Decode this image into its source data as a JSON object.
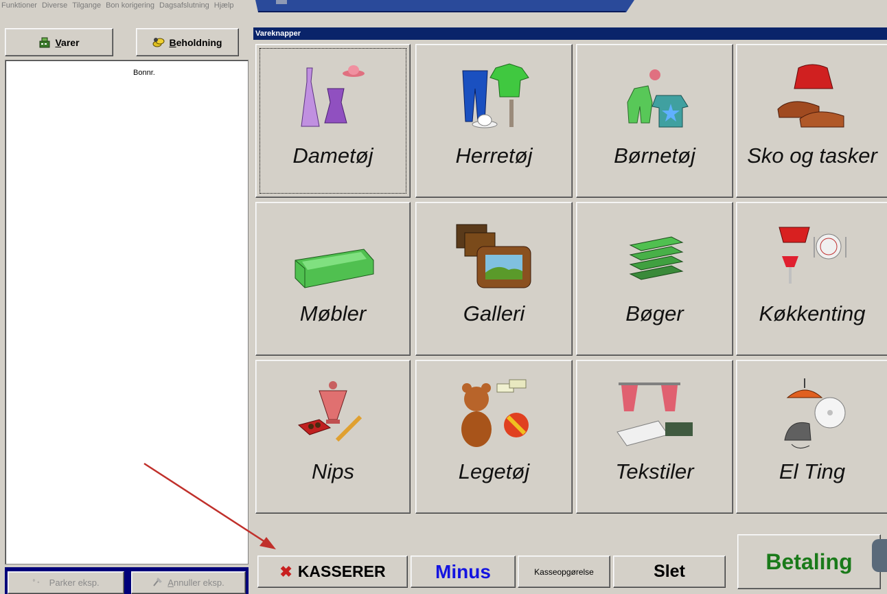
{
  "menu": [
    "Funktioner",
    "Diverse",
    "Tilgange",
    "Bon korigering",
    "Dagsafslutning",
    "Hjælp"
  ],
  "left": {
    "varer_label": "Varer",
    "varer_key": "V",
    "beholdning_label": "Beholdning",
    "beholdning_key": "B",
    "list_header": "Bonnr.",
    "parker_label": "Parker eksp.",
    "annuller_label": "Annuller eksp.",
    "annuller_key": "A"
  },
  "panel": {
    "title": "Vareknapper",
    "tiles": [
      {
        "label": "Dametøj",
        "icon": "dress-swimsuit-hat-icon"
      },
      {
        "label": "Herretøj",
        "icon": "pants-shirt-hat-tie-icon"
      },
      {
        "label": "Børnetøj",
        "icon": "baby-clothes-icon"
      },
      {
        "label": "Sko og tasker",
        "icon": "shoes-purse-icon"
      },
      {
        "label": "Møbler",
        "icon": "sofa-icon"
      },
      {
        "label": "Galleri",
        "icon": "picture-frames-icon"
      },
      {
        "label": "Bøger",
        "icon": "books-icon"
      },
      {
        "label": "Køkkenting",
        "icon": "kitchenware-icon"
      },
      {
        "label": "Nips",
        "icon": "vase-chocolate-icon"
      },
      {
        "label": "Legetøj",
        "icon": "teddy-ball-icon"
      },
      {
        "label": "Tekstiler",
        "icon": "curtains-fabric-icon"
      },
      {
        "label": "El Ting",
        "icon": "lamp-fan-iron-icon"
      }
    ]
  },
  "bottom": {
    "kasserer_label": "KASSERER",
    "minus_label": "Minus",
    "kasseopgorelse_label": "Kasseopgørelse",
    "slet_label": "Slet",
    "betaling_label": "Betaling"
  },
  "colors": {
    "face": "#d4d0c8",
    "titlebar": "#0a246a",
    "betaling": "#1a7a1a",
    "minus": "#1414e0",
    "arrow": "#c0302b"
  }
}
